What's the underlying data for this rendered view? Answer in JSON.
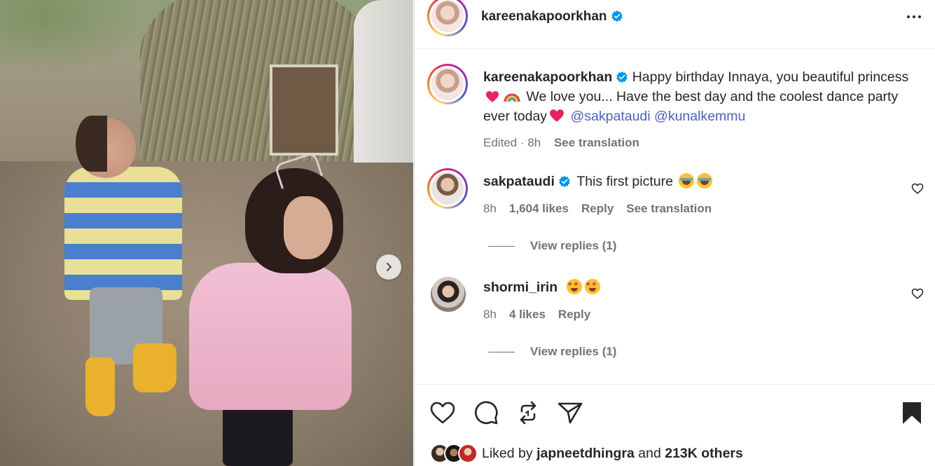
{
  "post": {
    "author": "kareenakapoorkhan",
    "caption_text": "Happy birthday Innaya, you beautiful princess",
    "caption_text_2": "We love you... Have the best day and the coolest dance party ever today",
    "mentions": [
      "@sakpataudi",
      "@kunalkemmu"
    ],
    "edited_label": "Edited",
    "time": "8h",
    "see_translation": "See translation"
  },
  "comments": [
    {
      "username": "sakpataudi",
      "verified": true,
      "text": "This first picture",
      "time": "8h",
      "likes": "1,604 likes",
      "reply": "Reply",
      "see_translation": "See translation",
      "view_replies": "View replies (1)"
    },
    {
      "username": "shormi_irin",
      "verified": false,
      "text": "",
      "time": "8h",
      "likes": "4 likes",
      "reply": "Reply",
      "view_replies": "View replies (1)"
    }
  ],
  "liked_by": {
    "prefix": "Liked by",
    "user": "japneetdhingra",
    "conjunction": "and",
    "others": "213K others"
  },
  "colors": {
    "verified": "#0095f6",
    "mention": "#4a5fd8",
    "heart_emoji": "#e8245e",
    "secondary_text": "#737373"
  },
  "icons": [
    "next-arrow-icon",
    "more-options-icon",
    "heart-icon",
    "comment-icon",
    "repost-icon",
    "share-icon",
    "bookmark-icon",
    "verified-badge-icon"
  ]
}
